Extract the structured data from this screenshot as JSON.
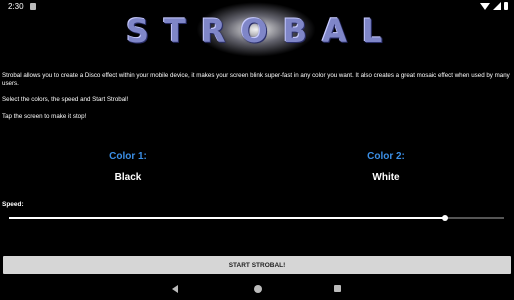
{
  "status_bar": {
    "time": "2:30"
  },
  "app": {
    "logo_text": "STROBAL"
  },
  "description": {
    "p1": "Strobal allows you to create a Disco effect within your mobile device, it makes your screen blink super-fast in any color you want. It also creates a great mosaic effect when used by many users.",
    "p2": "Select the colors, the speed and Start Strobal!",
    "p3": "Tap the screen to make it stop!"
  },
  "color1": {
    "label": "Color 1:",
    "value": "Black"
  },
  "color2": {
    "label": "Color 2:",
    "value": "White"
  },
  "speed": {
    "label": "Speed:",
    "value_fraction": 0.88
  },
  "start_button": {
    "label": "START STROBAL!"
  },
  "colors": {
    "accent": "#3b8fe6",
    "background": "#000000",
    "button": "#d6d6d6"
  },
  "icons": [
    "wifi-icon",
    "signal-icon",
    "battery-icon",
    "back-icon",
    "home-icon",
    "recents-icon"
  ]
}
